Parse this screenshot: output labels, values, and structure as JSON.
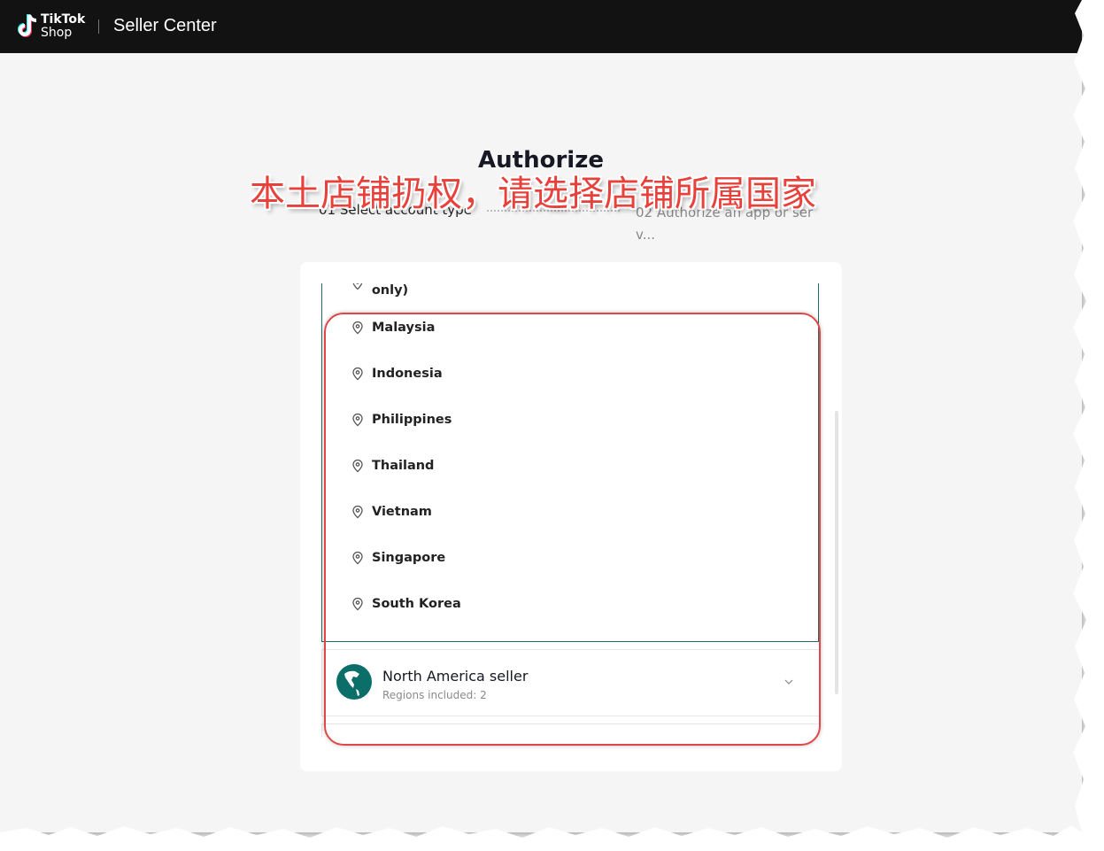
{
  "header": {
    "logo_line1": "TikTok",
    "logo_line2": "Shop",
    "brand": "Seller Center"
  },
  "page": {
    "title": "Authorize",
    "step1": "01 Select account type",
    "step2": "02 Authorize an app or ser v..."
  },
  "regions": {
    "cut_item": "Chinese mainland and the Hong Kong SAR (Cross-Border only)",
    "items": [
      "Malaysia",
      "Indonesia",
      "Philippines",
      "Thailand",
      "Vietnam",
      "Singapore",
      "South Korea"
    ]
  },
  "north_america": {
    "title": "North America seller",
    "subtitle": "Regions included: 2"
  },
  "annotation": {
    "text": "本土店铺扔权，请选择店铺所属国家"
  },
  "colors": {
    "topbar": "#121212",
    "accent_teal": "#1f6a6a",
    "highlight_red": "#e04848",
    "annotation_red": "#e8413c"
  }
}
